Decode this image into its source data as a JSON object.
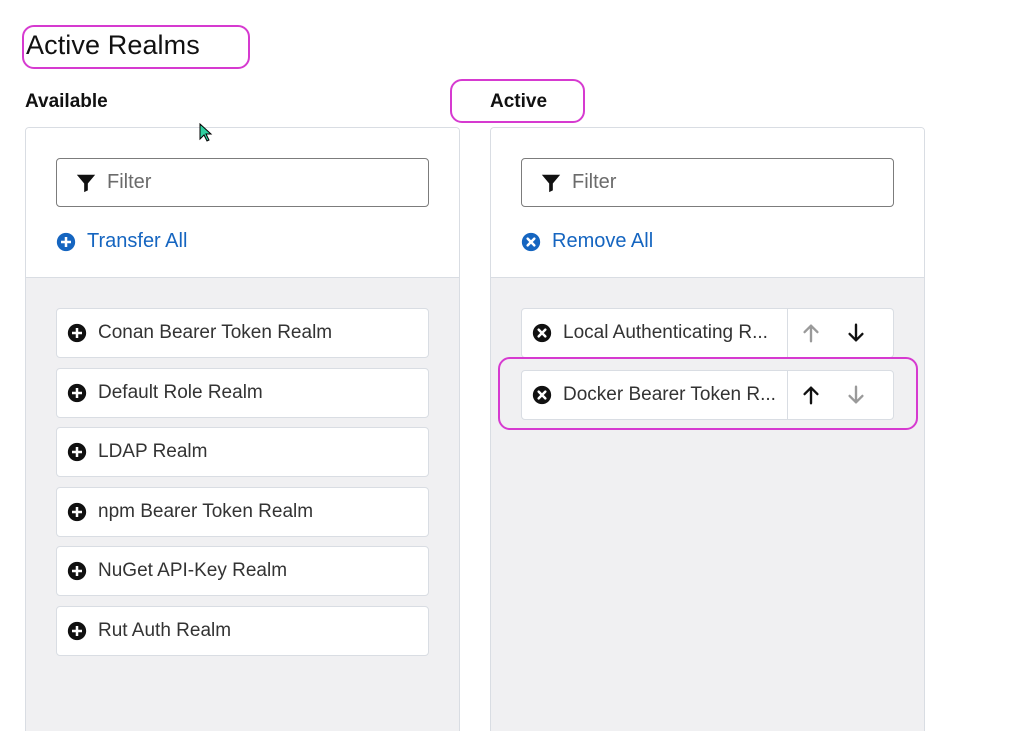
{
  "page": {
    "title": "Active Realms"
  },
  "available": {
    "label": "Available",
    "filter_placeholder": "Filter",
    "transfer_all_label": "Transfer All",
    "items": [
      {
        "label": "Conan Bearer Token Realm"
      },
      {
        "label": "Default Role Realm"
      },
      {
        "label": "LDAP Realm"
      },
      {
        "label": "npm Bearer Token Realm"
      },
      {
        "label": "NuGet API-Key Realm"
      },
      {
        "label": "Rut Auth Realm"
      }
    ]
  },
  "active": {
    "label": "Active",
    "filter_placeholder": "Filter",
    "remove_all_label": "Remove All",
    "items": [
      {
        "label": "Local Authenticating R...",
        "up_enabled": false,
        "down_enabled": true
      },
      {
        "label": "Docker Bearer Token R...",
        "up_enabled": true,
        "down_enabled": false
      }
    ]
  },
  "colors": {
    "accent": "#1565c0",
    "highlight": "#d63ad0",
    "list_background": "#f0f0f2",
    "border": "#d9dde3",
    "arrow_enabled": "#111111",
    "arrow_disabled": "#9a9a9a"
  },
  "icons": {
    "filter": "filter-icon",
    "transfer_all": "plus-circle-icon",
    "remove_all": "times-circle-icon",
    "add_item": "plus-circle-icon",
    "remove_item": "times-circle-icon",
    "move_up": "arrow-up-icon",
    "move_down": "arrow-down-icon"
  }
}
